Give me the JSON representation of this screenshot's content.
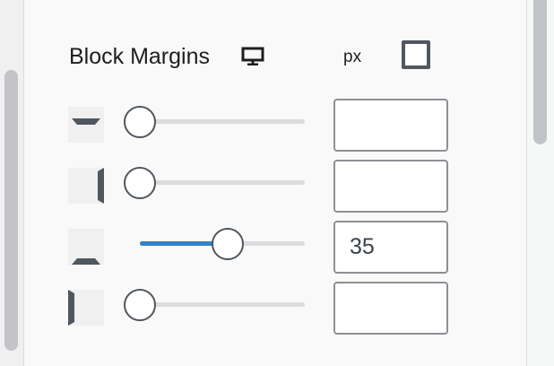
{
  "header": {
    "title": "Block Margins",
    "device_icon": "desktop-icon",
    "unit": "px",
    "toggle_icon": "all-sides-linked-icon"
  },
  "rows": [
    {
      "side": "top",
      "icon": "margin-top-icon",
      "value": "",
      "slider_fraction": 0
    },
    {
      "side": "right",
      "icon": "margin-right-icon",
      "value": "",
      "slider_fraction": 0
    },
    {
      "side": "bottom",
      "icon": "margin-bottom-icon",
      "value": "35",
      "slider_fraction": 0.53
    },
    {
      "side": "left",
      "icon": "margin-left-icon",
      "value": "",
      "slider_fraction": 0
    }
  ],
  "colors": {
    "accent": "#3582c4",
    "border": "#8c8f94",
    "icon_dark": "#50575e",
    "icon_bg": "#f0f0f1"
  }
}
